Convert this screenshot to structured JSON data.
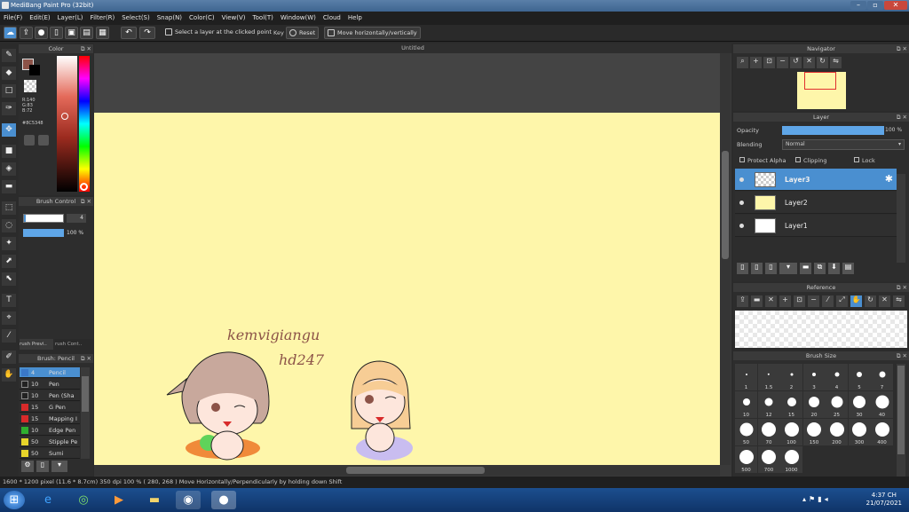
{
  "window": {
    "title": "MediBang Paint Pro (32bit)"
  },
  "menu": [
    "File(F)",
    "Edit(E)",
    "Layer(L)",
    "Filter(R)",
    "Select(S)",
    "Snap(N)",
    "Color(C)",
    "View(V)",
    "Tool(T)",
    "Window(W)",
    "Cloud",
    "Help"
  ],
  "toolbar": {
    "select_layer_label": "Select a layer at the clicked point",
    "key_label": "Key",
    "reset_label": "Reset",
    "move_label": "Move horizontally/vertically"
  },
  "color_panel": {
    "title": "Color",
    "rgb_r": "R:140",
    "rgb_g": "G:83",
    "rgb_b": "B:72",
    "hex": "#8C5348",
    "fg_color": "#8C5348"
  },
  "brush_control": {
    "title": "Brush Control",
    "size": "4",
    "opacity": "100 %"
  },
  "brush_tabs": {
    "preview": "rush Previ..",
    "control": "rush Cont.."
  },
  "brush_list": {
    "title": "Brush: Pencil",
    "items": [
      {
        "size": "4",
        "name": "Pencil",
        "color": "#3a78c8"
      },
      {
        "size": "10",
        "name": "Pen",
        "color": "#222222"
      },
      {
        "size": "10",
        "name": "Pen (Sha",
        "color": "#222222"
      },
      {
        "size": "15",
        "name": "G Pen",
        "color": "#d82a2a"
      },
      {
        "size": "15",
        "name": "Mapping I",
        "color": "#d82a2a"
      },
      {
        "size": "10",
        "name": "Edge Pen",
        "color": "#2fae2f"
      },
      {
        "size": "50",
        "name": "Stipple Pe",
        "color": "#e7d42a"
      },
      {
        "size": "50",
        "name": "Sumi",
        "color": "#e7d42a"
      }
    ]
  },
  "document": {
    "tab_title": "Untitled",
    "signature_line1": "kemvigiangu",
    "signature_line2": "hd247",
    "paper_color": "#FEF6AA"
  },
  "navigator": {
    "title": "Navigator"
  },
  "layer_panel": {
    "title": "Layer",
    "opacity_label": "Opacity",
    "opacity_value": "100 %",
    "blending_label": "Blending",
    "blending_value": "Normal",
    "protect_alpha": "Protect Alpha",
    "clipping": "Clipping",
    "lock": "Lock",
    "layers": [
      "Layer3",
      "Layer2",
      "Layer1"
    ]
  },
  "reference": {
    "title": "Reference"
  },
  "brush_size": {
    "title": "Brush Size",
    "sizes": [
      "1",
      "1.5",
      "2",
      "3",
      "4",
      "5",
      "7",
      "10",
      "12",
      "15",
      "20",
      "25",
      "30",
      "40",
      "50",
      "70",
      "100",
      "150",
      "200",
      "300",
      "400",
      "500",
      "700",
      "1000"
    ]
  },
  "status_bar": {
    "text": "1600 * 1200 pixel  (11.6 * 8.7cm)  350 dpi  100 %  ( 280, 268 )  Move Horizontally/Perpendicularly by holding down Shift"
  },
  "taskbar": {
    "time": "4:37 CH",
    "date": "21/07/2021"
  }
}
